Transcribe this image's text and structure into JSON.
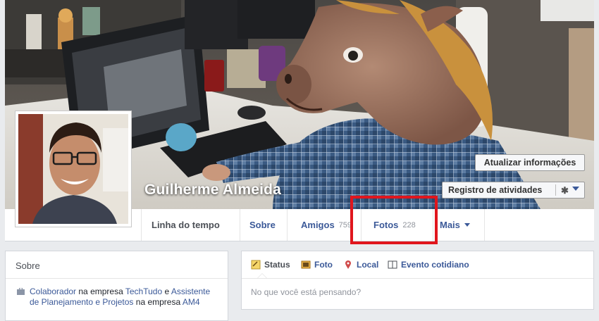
{
  "profile": {
    "name": "Guilherme Almeida",
    "update_info_label": "Atualizar informações",
    "activity_log_label": "Registro de atividades",
    "settings_icon": "gear-icon"
  },
  "nav": {
    "tabs": [
      {
        "label": "Linha do tempo",
        "count": ""
      },
      {
        "label": "Sobre",
        "count": ""
      },
      {
        "label": "Amigos",
        "count": "759"
      },
      {
        "label": "Fotos",
        "count": "228"
      },
      {
        "label": "Mais",
        "count": ""
      }
    ]
  },
  "about": {
    "title": "Sobre",
    "work": {
      "role": "Colaborador",
      "connector": " na empresa ",
      "company": "TechTudo",
      "connector2": " e ",
      "role2": "Assistente de Planejamento e Projetos",
      "connector3": " na empresa ",
      "company2": "AM4"
    }
  },
  "composer": {
    "tabs": [
      {
        "label": "Status",
        "icon": "status-icon"
      },
      {
        "label": "Foto",
        "icon": "photo-icon"
      },
      {
        "label": "Local",
        "icon": "location-icon"
      },
      {
        "label": "Evento cotidiano",
        "icon": "book-icon"
      }
    ],
    "placeholder": "No que você está pensando?"
  },
  "colors": {
    "brand": "#3b5998",
    "highlight": "#e0161d",
    "background": "#e9ebee"
  }
}
